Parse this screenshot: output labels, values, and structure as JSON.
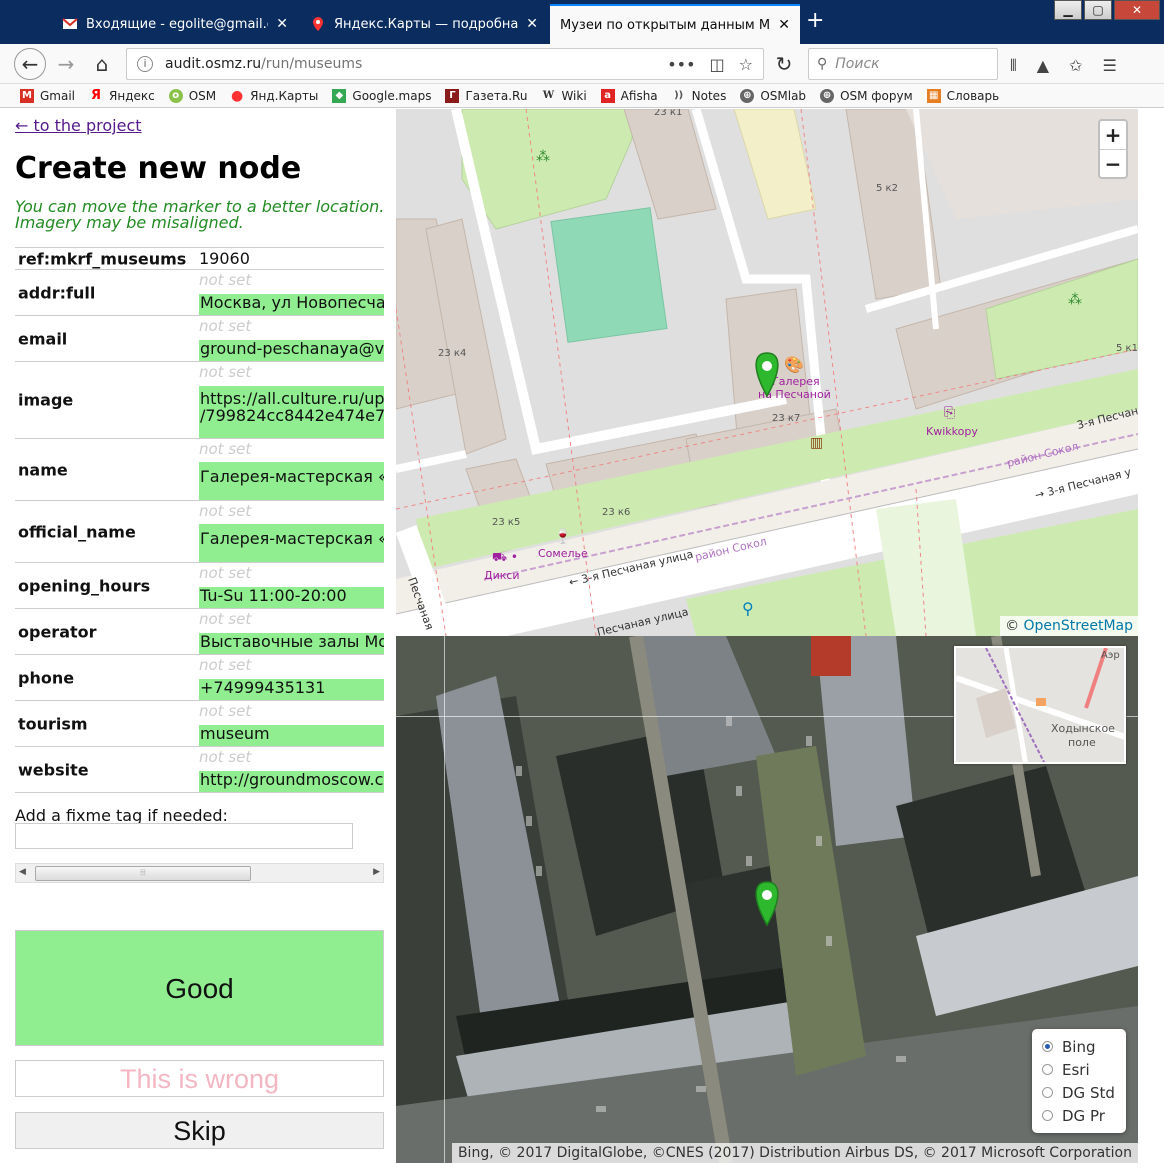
{
  "browser": {
    "tabs": [
      {
        "label": "Входящие - egolite@gmail.com",
        "active": false
      },
      {
        "label": "Яндекс.Карты — подробная ка",
        "active": false
      },
      {
        "label": "Музеи по открытым данным Минк",
        "active": true
      }
    ],
    "url_domain": "audit.osmz.ru",
    "url_path": "/run/museums",
    "search_placeholder": "Поиск",
    "bookmarks": [
      "Gmail",
      "Яндекс",
      "OSM",
      "Янд.Карты",
      "Google.maps",
      "Газета.Ru",
      "Wiki",
      "Afisha",
      "Notes",
      "OSMlab",
      "OSM форум",
      "Словарь"
    ]
  },
  "page": {
    "back_link": "← to the project",
    "title": "Create new node",
    "hint_line1": "You can move the marker to a better location.",
    "hint_line2": "Imagery may be misaligned.",
    "not_set": "not set",
    "tags": [
      {
        "key": "ref:mkrf_museums",
        "value": "19060",
        "type": "plain"
      },
      {
        "key": "addr:full",
        "value": "Москва, ул Новопесчан",
        "type": "new"
      },
      {
        "key": "email",
        "value": "ground-peschanaya@vz",
        "type": "new"
      },
      {
        "key": "image",
        "value": "https://all.culture.ru/up\n/799824cc8442e474e7e",
        "type": "new"
      },
      {
        "key": "name",
        "value": "Галерея-мастерская «Г",
        "type": "new"
      },
      {
        "key": "official_name",
        "value": "Галерея-мастерская «Г",
        "type": "new"
      },
      {
        "key": "opening_hours",
        "value": "Tu-Su 11:00-20:00",
        "type": "new"
      },
      {
        "key": "operator",
        "value": "Выставочные залы Мос",
        "type": "new"
      },
      {
        "key": "phone",
        "value": "+74999435131",
        "type": "new"
      },
      {
        "key": "tourism",
        "value": "museum",
        "type": "new"
      },
      {
        "key": "website",
        "value": "http://groundmoscow.c",
        "type": "new"
      }
    ],
    "fixme_label": "Add a fixme tag if needed:",
    "fixme_value": "",
    "good_label": "Good",
    "wrong_label": "This is wrong",
    "skip_label": "Skip"
  },
  "map": {
    "zoom_in": "+",
    "zoom_out": "−",
    "osm_attribution_prefix": "©",
    "osm_attribution_link": "OpenStreetMap",
    "labels": {
      "b23k1": "23 к1",
      "b5k2": "5 к2",
      "b23k4": "23 к4",
      "b5k1": "5 к1",
      "b23k7": "23 к7",
      "b23k5": "23 к5",
      "b23k6": "23 к6",
      "gallery1": "Галерея",
      "gallery2": "на Песчаной",
      "kwikkopy": "Kwikkopy",
      "somelie": "Сомелье",
      "diksi": "Дикси",
      "street_east1": "3-я Песчаная",
      "street_east2": "→ 3-я Песчаная у",
      "street_main": "← 3-я Песчаная улица",
      "street_low": "Песчаная улица",
      "street_vert": "Песчаная",
      "district1": "район Сокол",
      "district2": "район Сокол"
    },
    "minimap_label1": "Ходынское",
    "minimap_label2": "поле",
    "minimap_label3": "Аэр",
    "sat_attribution": "Bing, © 2017 DigitalGlobe, ©CNES (2017) Distribution Airbus DS, © 2017 Microsoft Corporation",
    "layers": [
      {
        "label": "Bing",
        "selected": true
      },
      {
        "label": "Esri",
        "selected": false
      },
      {
        "label": "DG Std",
        "selected": false
      },
      {
        "label": "DG Pr",
        "selected": false
      }
    ]
  },
  "colors": {
    "accent_green": "#90ee90",
    "link_purple": "#551a8b",
    "hint_green": "#228b22",
    "wrong_pink": "#f4b6c2",
    "marker_green": "#2eb82e"
  }
}
